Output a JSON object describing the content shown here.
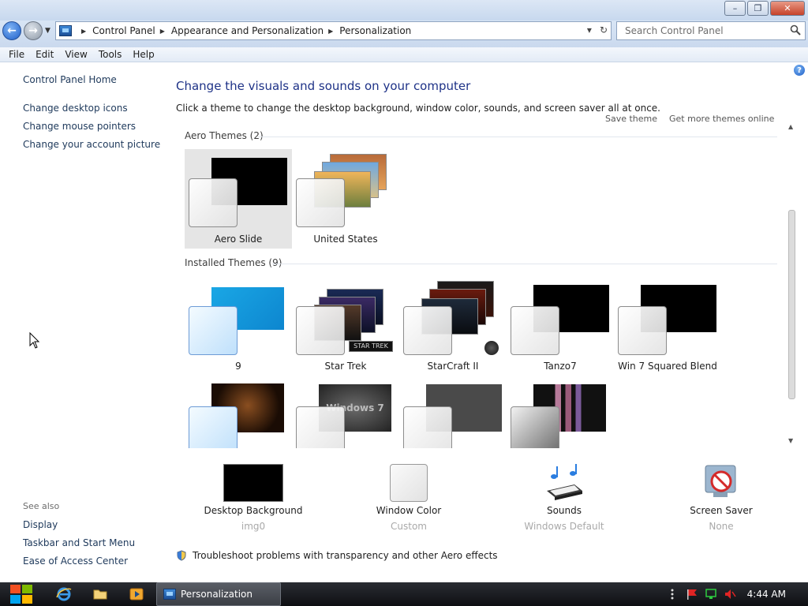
{
  "window": {
    "controls": {
      "minimize": "–",
      "maximize": "❐",
      "close": "✕"
    }
  },
  "address": {
    "crumbs": [
      "Control Panel",
      "Appearance and Personalization",
      "Personalization"
    ],
    "search_placeholder": "Search Control Panel"
  },
  "menu": [
    "File",
    "Edit",
    "View",
    "Tools",
    "Help"
  ],
  "sidebar": {
    "home": "Control Panel Home",
    "links": [
      "Change desktop icons",
      "Change mouse pointers",
      "Change your account picture"
    ],
    "see_also_label": "See also",
    "see_also": [
      "Display",
      "Taskbar and Start Menu",
      "Ease of Access Center"
    ]
  },
  "main": {
    "title": "Change the visuals and sounds on your computer",
    "subtitle": "Click a theme to change the desktop background, window color, sounds, and screen saver all at once.",
    "save_theme": "Save theme",
    "get_more": "Get more themes online",
    "aero_group": "Aero Themes (2)",
    "installed_group": "Installed Themes (9)",
    "aero_themes": [
      "Aero Slide",
      "United States"
    ],
    "installed_themes": [
      "9",
      "Star Trek",
      "StarCraft II",
      "Tanzo7",
      "Win 7 Squared Blend"
    ],
    "selected_theme": "Aero Slide",
    "thumbnail_texts": {
      "star_trek_badge": "STAR TREK",
      "windows7": "Windows 7"
    }
  },
  "settings": {
    "desktop_background": {
      "title": "Desktop Background",
      "value": "img0"
    },
    "window_color": {
      "title": "Window Color",
      "value": "Custom"
    },
    "sounds": {
      "title": "Sounds",
      "value": "Windows Default"
    },
    "screen_saver": {
      "title": "Screen Saver",
      "value": "None"
    }
  },
  "troubleshoot": "Troubleshoot problems with transparency and other Aero effects",
  "taskbar": {
    "active_window": "Personalization",
    "clock": "4:44 AM"
  },
  "colors": {
    "link": "#1e395b",
    "title": "#1e3287",
    "muted": "#a9a9a9",
    "selected_bg": "#e5e5e5"
  }
}
